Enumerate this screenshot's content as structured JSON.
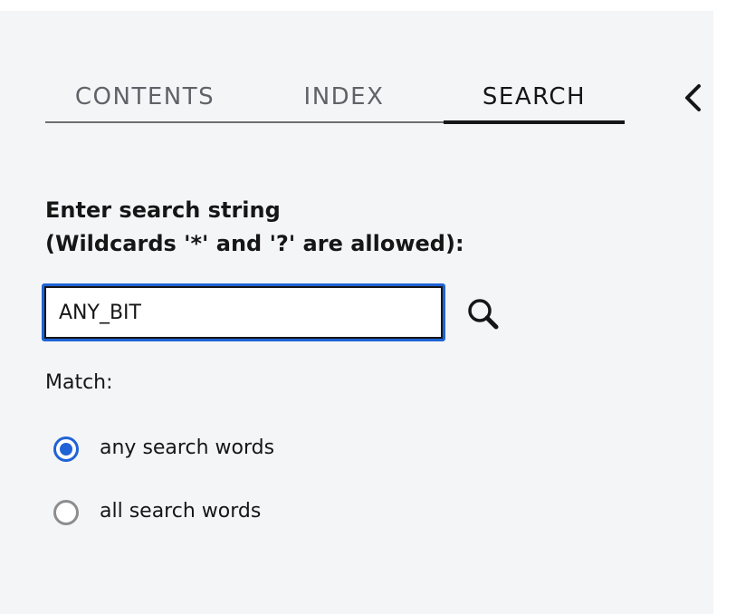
{
  "tabs": {
    "contents": "CONTENTS",
    "index": "INDEX",
    "search": "SEARCH",
    "active": "search"
  },
  "icons": {
    "collapse": "chevron-left-icon",
    "search": "magnifier-icon"
  },
  "search": {
    "prompt_line1": "Enter search string",
    "prompt_line2": "(Wildcards '*' and '?' are allowed):",
    "value": "ANY_BIT"
  },
  "match": {
    "label": "Match:",
    "options": [
      {
        "label": "any search words",
        "selected": true
      },
      {
        "label": "all search words",
        "selected": false
      }
    ]
  },
  "colors": {
    "accent": "#1f63d6",
    "panel_bg": "#f4f5f7",
    "text": "#161616",
    "inactive_tab": "#5f6368",
    "radio_off": "#8d8d8d"
  }
}
